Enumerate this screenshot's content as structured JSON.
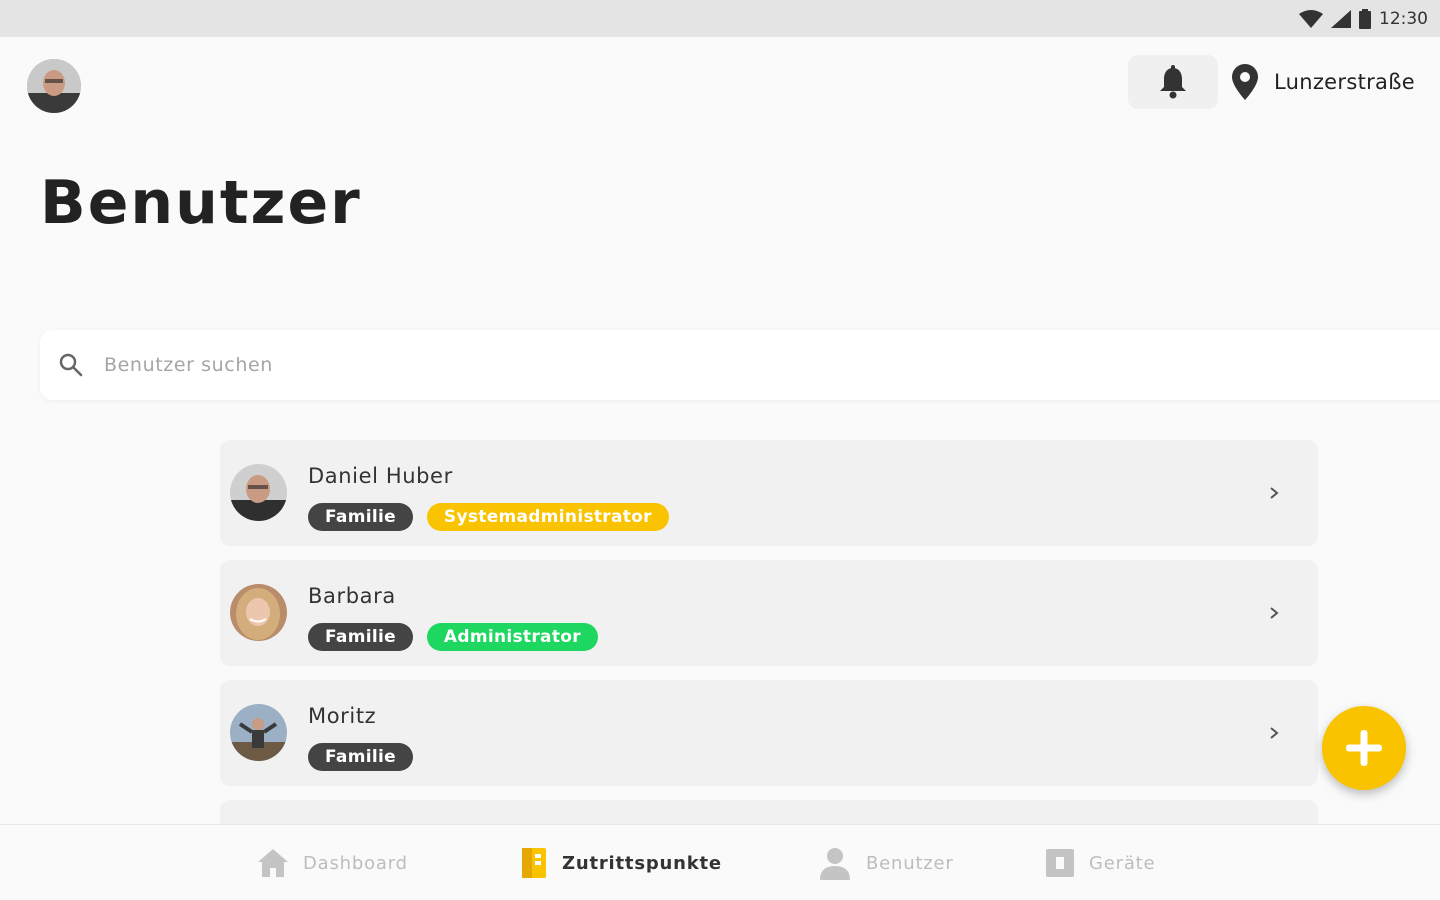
{
  "status_bar": {
    "time": "12:30"
  },
  "header": {
    "location_label": "Lunzerstraße"
  },
  "page_title": "Benutzer",
  "search": {
    "placeholder": "Benutzer suchen"
  },
  "users": [
    {
      "name": "Daniel Huber",
      "badges": [
        {
          "label": "Familie"
        },
        {
          "label": "Systemadministrator"
        }
      ]
    },
    {
      "name": "Barbara",
      "badges": [
        {
          "label": "Familie"
        },
        {
          "label": "Administrator"
        }
      ]
    },
    {
      "name": "Moritz",
      "badges": [
        {
          "label": "Familie"
        }
      ]
    }
  ],
  "bottom_nav": {
    "items": [
      {
        "label": "Dashboard",
        "icon": "home-icon"
      },
      {
        "label": "Zutrittspunkte",
        "icon": "door-icon"
      },
      {
        "label": "Benutzer",
        "icon": "person-icon"
      },
      {
        "label": "Geräte",
        "icon": "device-icon"
      }
    ],
    "active": "Zutrittspunkte"
  },
  "colors": {
    "accent": "#f9c300",
    "admin_green": "#1ed760",
    "badge_dark": "#444444"
  }
}
